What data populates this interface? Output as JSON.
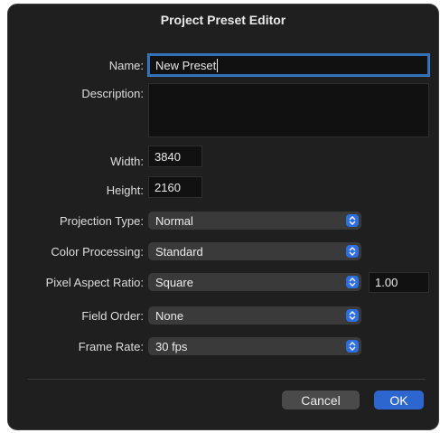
{
  "dialog": {
    "title": "Project Preset Editor"
  },
  "fields": {
    "name_label": "Name:",
    "name_value": "New Preset",
    "description_label": "Description:",
    "description_value": "",
    "width_label": "Width:",
    "width_value": "3840",
    "height_label": "Height:",
    "height_value": "2160",
    "pixel_aspect_value": "1.00"
  },
  "popups": {
    "projection_type_label": "Projection Type:",
    "projection_type_value": "Normal",
    "color_processing_label": "Color Processing:",
    "color_processing_value": "Standard",
    "pixel_aspect_ratio_label": "Pixel Aspect Ratio:",
    "pixel_aspect_ratio_value": "Square",
    "field_order_label": "Field Order:",
    "field_order_value": "None",
    "frame_rate_label": "Frame Rate:",
    "frame_rate_value": "30 fps"
  },
  "buttons": {
    "cancel_label": "Cancel",
    "ok_label": "OK"
  },
  "icons": {
    "popup_indicator": "chevron-up-down-icon"
  },
  "colors": {
    "accent": "#2e66d0",
    "background": "#1f1f1f"
  }
}
